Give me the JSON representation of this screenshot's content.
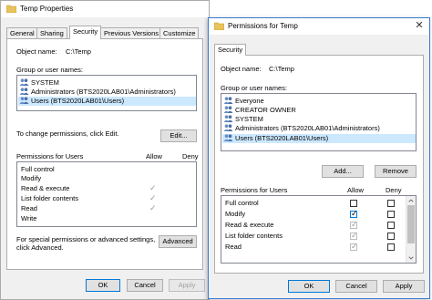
{
  "background_window": {
    "title": "Temp Properties",
    "close_glyph": "✕",
    "tabs": [
      {
        "label": "General"
      },
      {
        "label": "Sharing"
      },
      {
        "label": "Security"
      },
      {
        "label": "Previous Versions"
      },
      {
        "label": "Customize"
      }
    ],
    "active_tab": "Security",
    "object_name_label": "Object name:",
    "object_name_value": "C:\\Temp",
    "group_label": "Group or user names:",
    "users": [
      {
        "name": "SYSTEM"
      },
      {
        "name": "Administrators (BTS2020LAB01\\Administrators)"
      },
      {
        "name": "Users (BTS2020LAB01\\Users)",
        "selected": true
      }
    ],
    "change_perm_text": "To change permissions, click Edit.",
    "edit_button": "Edit...",
    "perm_header": "Permissions for Users",
    "allow_header": "Allow",
    "deny_header": "Deny",
    "permissions": [
      {
        "name": "Full control",
        "allow": false
      },
      {
        "name": "Modify",
        "allow": false
      },
      {
        "name": "Read & execute",
        "allow": true
      },
      {
        "name": "List folder contents",
        "allow": true
      },
      {
        "name": "Read",
        "allow": true
      },
      {
        "name": "Write",
        "allow": false
      }
    ],
    "special_text_line1": "For special permissions or advanced settings,",
    "special_text_line2": "click Advanced.",
    "advanced_button": "Advanced",
    "ok_button": "OK",
    "cancel_button": "Cancel",
    "apply_button": "Apply",
    "check_glyph": "✓"
  },
  "foreground_window": {
    "title": "Permissions for Temp",
    "close_glyph": "✕",
    "tab": "Security",
    "object_name_label": "Object name:",
    "object_name_value": "C:\\Temp",
    "group_label": "Group or user names:",
    "users": [
      {
        "name": "Everyone"
      },
      {
        "name": "CREATOR OWNER"
      },
      {
        "name": "SYSTEM"
      },
      {
        "name": "Administrators (BTS2020LAB01\\Administrators)"
      },
      {
        "name": "Users (BTS2020LAB01\\Users)",
        "selected": true
      }
    ],
    "add_button": "Add...",
    "remove_button": "Remove",
    "perm_header": "Permissions for Users",
    "allow_header": "Allow",
    "deny_header": "Deny",
    "permissions": [
      {
        "name": "Full control",
        "allow": false,
        "allow_inherited": false,
        "deny": false
      },
      {
        "name": "Modify",
        "allow": true,
        "allow_inherited": false,
        "deny": false
      },
      {
        "name": "Read & execute",
        "allow": true,
        "allow_inherited": true,
        "deny": false
      },
      {
        "name": "List folder contents",
        "allow": true,
        "allow_inherited": true,
        "deny": false
      },
      {
        "name": "Read",
        "allow": true,
        "allow_inherited": true,
        "deny": false
      }
    ],
    "ok_button": "OK",
    "cancel_button": "Cancel",
    "apply_button": "Apply",
    "check_glyph": "✓"
  },
  "colors": {
    "selection": "#cce8ff",
    "accent_border": "#3a7bd5",
    "window_bg": "#f0f0f0",
    "folder": "#e8c25a"
  }
}
